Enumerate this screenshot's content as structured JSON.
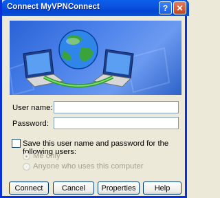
{
  "window": {
    "title": "Connect MyVPNConnect",
    "help_glyph": "?",
    "close_glyph": "✕"
  },
  "form": {
    "username_label": "User name:",
    "username_value": "",
    "password_label": "Password:",
    "password_value": "",
    "save_label": "Save this user name and password for the following users:",
    "save_checked": false,
    "radio_me_only": "Me only",
    "radio_anyone": "Anyone who uses this computer"
  },
  "buttons": {
    "connect": "Connect",
    "cancel": "Cancel",
    "properties": "Properties",
    "help": "Help"
  },
  "icons": {
    "banner": "network-globe-laptops-icon",
    "help": "help-icon",
    "close": "close-icon"
  },
  "colors": {
    "titlebar": "#0a5fea",
    "dialog_bg": "#ece9d8",
    "banner_blue": "#2a63d6",
    "globe_green": "#3aa43a"
  }
}
